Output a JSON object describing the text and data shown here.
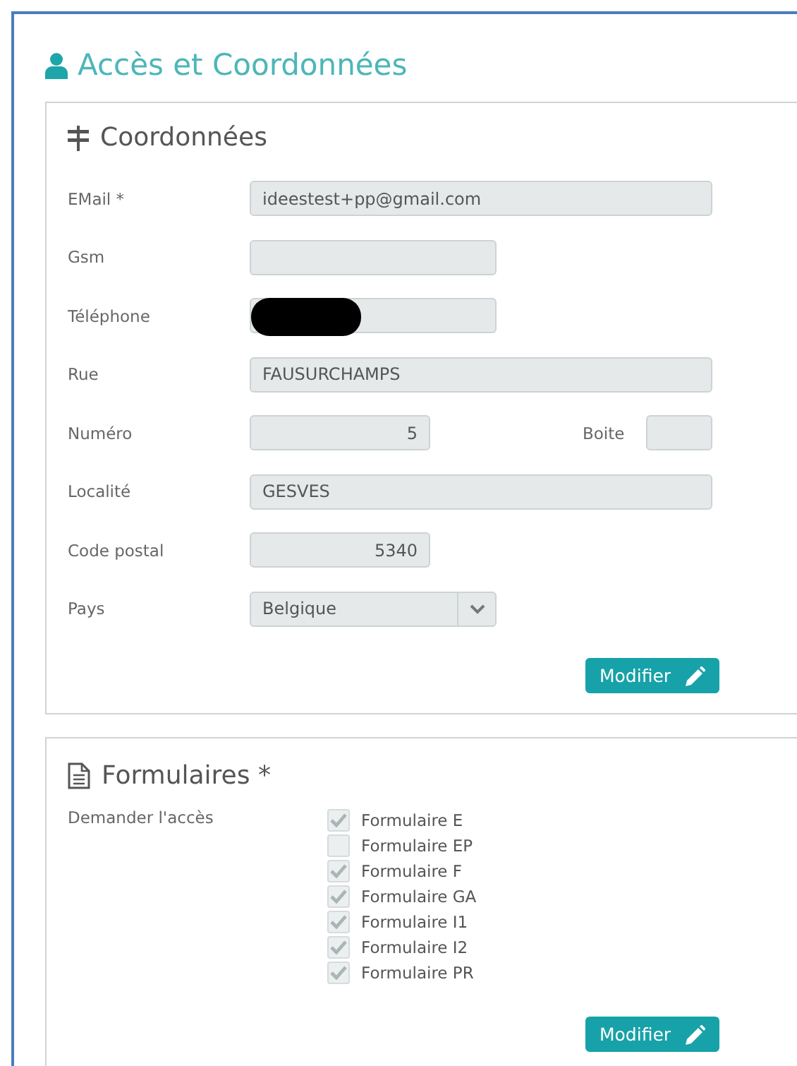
{
  "page": {
    "title": "Accès et Coordonnées"
  },
  "contact_card": {
    "title": "Coordonnées",
    "rows": [
      {
        "label": "EMail *",
        "field": {
          "kind": "wide",
          "value": "ideestest+pp@gmail.com"
        }
      },
      {
        "label": "Gsm",
        "field": {
          "kind": "medium"
        }
      },
      {
        "label": "Téléphone",
        "field": {
          "kind": "medium",
          "redacted": true
        }
      },
      {
        "label": "Rue",
        "field": {
          "kind": "wide",
          "value": "FAUSURCHAMPS"
        }
      },
      {
        "label": "Numéro",
        "field": {
          "kind": "number",
          "value": "5"
        },
        "extra": {
          "label": "Boite"
        }
      },
      {
        "label": "Localité",
        "field": {
          "kind": "wide",
          "value": "GESVES"
        }
      },
      {
        "label": "Code postal",
        "field": {
          "kind": "number",
          "value": "5340"
        }
      },
      {
        "label": "Pays",
        "field": {
          "kind": "select",
          "value": "Belgique"
        }
      }
    ],
    "button": "Modifier"
  },
  "forms_card": {
    "title": "Formulaires *",
    "label": "Demander l'accès",
    "options": [
      {
        "label": "Formulaire E",
        "checked": true
      },
      {
        "label": "Formulaire EP",
        "checked": false
      },
      {
        "label": "Formulaire F",
        "checked": true
      },
      {
        "label": "Formulaire GA",
        "checked": true
      },
      {
        "label": "Formulaire I1",
        "checked": true
      },
      {
        "label": "Formulaire I2",
        "checked": true
      },
      {
        "label": "Formulaire PR",
        "checked": true
      }
    ],
    "button": "Modifier"
  }
}
